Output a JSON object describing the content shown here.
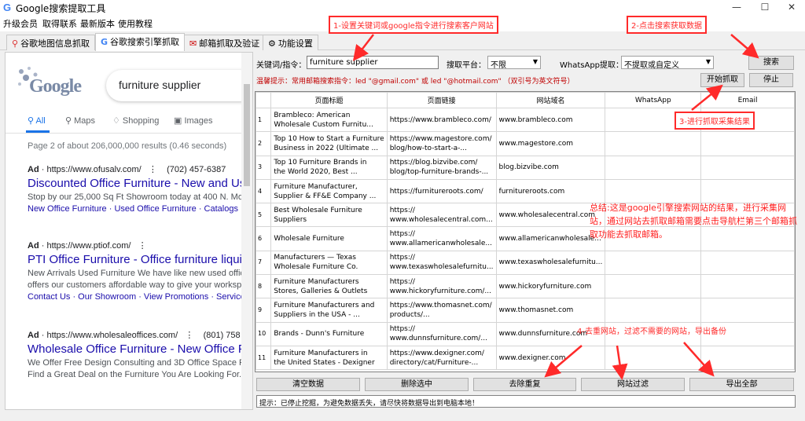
{
  "window": {
    "title": "Google搜索提取工具",
    "app_icon": "google-g-icon"
  },
  "menu": [
    "升级会员",
    "取得联系",
    "最新版本",
    "使用教程"
  ],
  "tabs": [
    {
      "label": "谷歌地图信息抓取",
      "icon": "map-pin-icon"
    },
    {
      "label": "谷歌搜索引擎抓取",
      "icon": "google-g-icon",
      "active": true
    },
    {
      "label": "邮箱抓取及验证",
      "icon": "mail-icon"
    },
    {
      "label": "功能设置",
      "icon": "gear-icon"
    }
  ],
  "browser": {
    "logo_text": "Google",
    "search_query": "furniture supplier",
    "nav": [
      "All",
      "Maps",
      "Shopping",
      "Images"
    ],
    "stats": "Page 2 of about 206,000,000 results (0.46 seconds)",
    "results": [
      {
        "url_prefix": "Ad",
        "url": "https://www.ofusalv.com/",
        "phone": "(702) 457-6387",
        "title": "Discounted Office Furniture - New and Us",
        "desc": [
          "Stop by our 25,000 Sq Ft Showroom today at 400 N. Mojave"
        ],
        "links": "New Office Furniture · Used Office Furniture · Catalogs · Be"
      },
      {
        "url_prefix": "Ad",
        "url": "https://www.ptiof.com/",
        "phone": "",
        "title": "PTI Office Furniture - Office furniture liqui",
        "desc": [
          "New Arrivals Used Furniture We have like new used office",
          "offers our customers affordable way to give your workspace"
        ],
        "links": "Contact Us · Our Showroom · View Promotions · Service Ar"
      },
      {
        "url_prefix": "Ad",
        "url": "https://www.wholesaleoffices.com/",
        "phone": "(801) 758",
        "title": "Wholesale Office Furniture - New Office F",
        "desc": [
          "We Offer Free Design Consulting and 3D Office Space Plan",
          "Find a Great Deal on the Furniture You Are Looking For. Ca"
        ],
        "links": ""
      }
    ]
  },
  "controls": {
    "keyword_label": "关键词/指令：",
    "keyword_value": "furniture supplier",
    "platform_label": "搜取平台：",
    "platform_value": "不限",
    "whatsapp_label": "WhatsApp提取：",
    "whatsapp_value": "不提取或自定义",
    "search_btn": "搜索",
    "start_btn": "开始抓取",
    "stop_btn": "停止",
    "warning": "温馨提示：常用邮箱搜索指令：led \"@gmail.com\" 或 led \"@hotmail.com\" （双引号为英文符号）"
  },
  "table": {
    "headers": [
      "",
      "页面标题",
      "页面链接",
      "网站域名",
      "WhatsApp",
      "Email"
    ],
    "rows": [
      {
        "n": "1",
        "title": [
          "Brambleco: American",
          "Wholesale Custom Furnitu..."
        ],
        "link": [
          "https://www.brambleco.com/"
        ],
        "domain": "www.brambleco.com"
      },
      {
        "n": "2",
        "title": [
          "Top 10 How to Start a Furniture",
          "Business in 2022 (Ultimate ..."
        ],
        "link": [
          "https://www.magestore.com/",
          "blog/how-to-start-a-..."
        ],
        "domain": "www.magestore.com"
      },
      {
        "n": "3",
        "title": [
          "Top 10 Furniture Brands in",
          "the World 2020, Best ..."
        ],
        "link": [
          "https://blog.bizvibe.com/",
          "blog/top-furniture-brands-..."
        ],
        "domain": "blog.bizvibe.com"
      },
      {
        "n": "4",
        "title": [
          "Furniture Manufacturer,",
          "Supplier & FF&E Company ..."
        ],
        "link": [
          "https://furnitureroots.com/"
        ],
        "domain": "furnitureroots.com"
      },
      {
        "n": "5",
        "title": [
          "Best Wholesale Furniture",
          "Suppliers"
        ],
        "link": [
          "https://",
          "www.wholesalecentral.com..."
        ],
        "domain": "www.wholesalecentral.com"
      },
      {
        "n": "6",
        "title": [
          "Wholesale Furniture"
        ],
        "link": [
          "https://",
          "www.allamericanwholesale..."
        ],
        "domain": "www.allamericanwholesale..."
      },
      {
        "n": "7",
        "title": [
          "Manufacturers — Texas",
          "Wholesale Furniture Co."
        ],
        "link": [
          "https://",
          "www.texaswholesalefurnitu..."
        ],
        "domain": "www.texaswholesalefurnitu..."
      },
      {
        "n": "8",
        "title": [
          "Furniture Manufacturers",
          "Stores, Galleries & Outlets"
        ],
        "link": [
          "https://",
          "www.hickoryfurniture.com/..."
        ],
        "domain": "www.hickoryfurniture.com"
      },
      {
        "n": "9",
        "title": [
          "Furniture Manufacturers and",
          "Suppliers in the USA - ..."
        ],
        "link": [
          "https://www.thomasnet.com/",
          "products/..."
        ],
        "domain": "www.thomasnet.com"
      },
      {
        "n": "10",
        "title": [
          "Brands - Dunn's Furniture"
        ],
        "link": [
          "https://",
          "www.dunnsfurniture.com/..."
        ],
        "domain": "www.dunnsfurniture.com"
      },
      {
        "n": "11",
        "title": [
          "Furniture Manufacturers in",
          "the United States - Dexigner"
        ],
        "link": [
          "https://www.dexigner.com/",
          "directory/cat/Furniture-..."
        ],
        "domain": "www.dexigner.com"
      }
    ]
  },
  "bottom_buttons": [
    "清空数据",
    "删除选中",
    "去除重复",
    "网站过滤",
    "导出全部"
  ],
  "hint": "提示：已停止挖掘，为避免数据丢失，请尽快将数据导出到电脑本地！",
  "annotations": {
    "a1": "1-设置关键词或google指令进行搜索客户网站",
    "a2": "2-点击搜索获取数据",
    "a3": "3-进行抓取采集结果",
    "a4": "4-去重网站，过滤不需要的网站，导出备份",
    "summary": "总结:这是google引擎搜索网站的结果，进行采集网站，通过网站去抓取邮箱需要点击导航栏第三个邮箱抓取功能去抓取邮箱。",
    "color": "#ff2a2a"
  }
}
